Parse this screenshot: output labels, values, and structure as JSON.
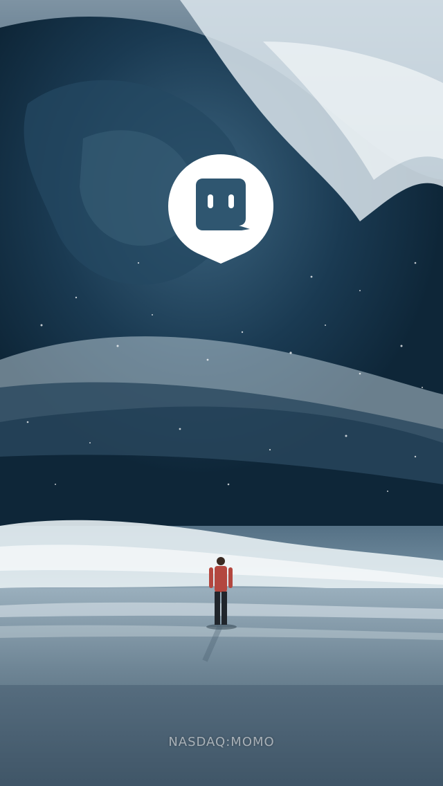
{
  "splash": {
    "brand_text": "NASDAQ:MOMO",
    "logo_icon": "momo-chat-bubble-logo-icon",
    "background": "tidal-wave-ocean-scene",
    "colors": {
      "logo": "#ffffff",
      "ocean_dark": "#0b2233",
      "ocean_mid": "#2b4d66",
      "foam": "#dfe8ee"
    }
  }
}
